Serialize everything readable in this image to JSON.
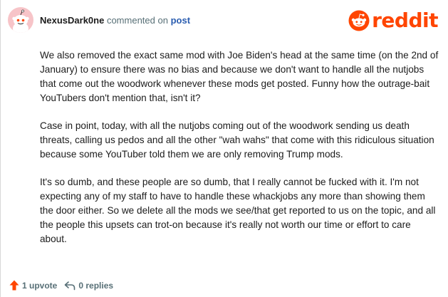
{
  "header": {
    "username": "NexusDark0ne",
    "action_text": "commented on",
    "post_link": "post"
  },
  "logo": {
    "word": "reddit",
    "icon": "reddit-alien-icon",
    "color": "#ff4500"
  },
  "comment": {
    "paragraphs": [
      "We also removed the exact same mod with Joe Biden's head at the same time (on the 2nd of January) to ensure there was no bias and because we don't want to handle all the nutjobs that come out the woodwork whenever these mods get posted. Funny how the outrage-bait YouTubers don't mention that, isn't it?",
      "Case in point, today, with all the nutjobs coming out of the woodwork sending us death threats, calling us pedos and all the other \"wah wahs\" that come with this ridiculous situation because some YouTuber told them we are only removing Trump mods.",
      "It's so dumb, and these people are so dumb, that I really cannot be fucked with it. I'm not expecting any of my staff to have to handle these whackjobs any more than showing them the door either. So we delete all the mods we see/that get reported to us on the topic, and all the people this upsets can trot-on because it's really not worth our time or effort to care about."
    ]
  },
  "footer": {
    "upvote_label": "1 upvote",
    "replies_label": "0 replies",
    "upvote_icon": "upvote-arrow-icon",
    "reply_icon": "reply-arrow-icon",
    "upvote_color": "#ff4500"
  },
  "avatar": {
    "background": "#f7c4c8"
  }
}
